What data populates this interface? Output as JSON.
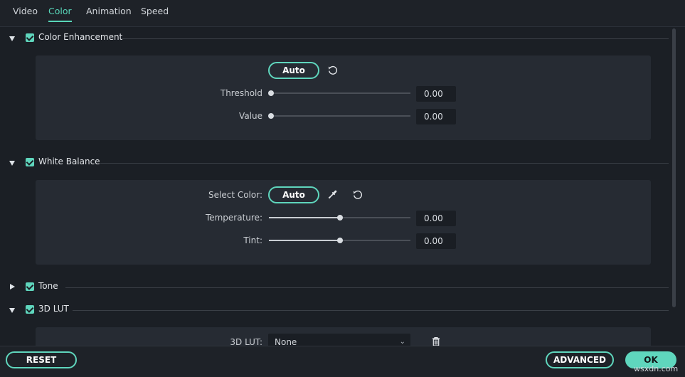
{
  "tabs": [
    {
      "label": "Video",
      "active": false
    },
    {
      "label": "Color",
      "active": true
    },
    {
      "label": "Animation",
      "active": false
    },
    {
      "label": "Speed",
      "active": false
    }
  ],
  "color_enhancement": {
    "title": "Color Enhancement",
    "expanded": true,
    "checked": true,
    "auto_label": "Auto",
    "threshold": {
      "label": "Threshold",
      "value": "0.00",
      "fraction": 0.0
    },
    "value": {
      "label": "Value",
      "value": "0.00",
      "fraction": 0.0
    }
  },
  "white_balance": {
    "title": "White Balance",
    "expanded": true,
    "checked": true,
    "select_color_label": "Select Color:",
    "auto_label": "Auto",
    "temperature": {
      "label": "Temperature:",
      "value": "0.00",
      "fraction": 0.5
    },
    "tint": {
      "label": "Tint:",
      "value": "0.00",
      "fraction": 0.5
    }
  },
  "tone": {
    "title": "Tone",
    "expanded": false,
    "checked": true
  },
  "lut": {
    "title": "3D LUT",
    "expanded": true,
    "checked": true,
    "field_label": "3D LUT:",
    "selected": "None"
  },
  "footer": {
    "reset_label": "RESET",
    "advanced_label": "ADVANCED",
    "ok_label": "OK"
  },
  "watermark": "wsxdn.com",
  "colors": {
    "accent": "#5fd6bd",
    "background": "#1b1f25",
    "panel": "#262b33"
  },
  "icons": [
    "reset-icon",
    "eyedropper-icon",
    "trash-icon",
    "chevron-down-icon",
    "caret-down-icon",
    "caret-right-icon",
    "checkbox-checked-icon"
  ]
}
